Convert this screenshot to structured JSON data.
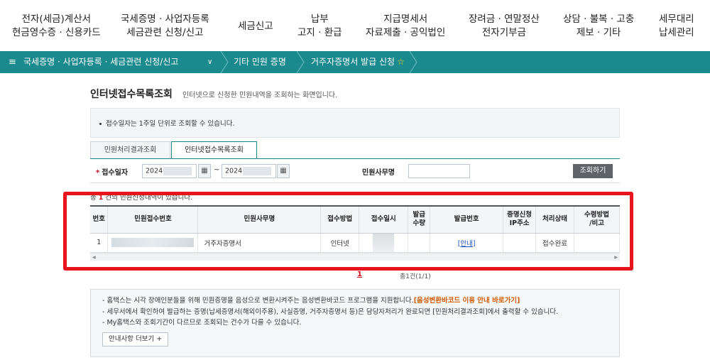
{
  "topnav": [
    {
      "line1": "전자(세금)계산서",
      "line2": "현금영수증 · 신용카드"
    },
    {
      "line1": "국세증명 · 사업자등록",
      "line2": "세금관련 신청/신고"
    },
    {
      "line1": "세금신고",
      "line2": ""
    },
    {
      "line1": "납부",
      "line2": "고지 · 환급"
    },
    {
      "line1": "지급명세서",
      "line2": "자료제출 · 공익법인"
    },
    {
      "line1": "장려금 · 연말정산",
      "line2": "전자기부금"
    },
    {
      "line1": "상담 · 불복 · 고충",
      "line2": "제보 · 기타"
    },
    {
      "line1": "세무대리",
      "line2": "납세관리"
    }
  ],
  "breadcrumb": {
    "menu_icon": "≡",
    "menu_label": "국세증명 · 사업자등록 · 세금관련 신청/신고",
    "chevron": "∨",
    "item2": "기타 민원 증명",
    "item3": "거주자증명서 발급 신청",
    "star": "☆"
  },
  "page": {
    "title": "인터넷접수목록조회",
    "description": "인터넷으로 신청한 민원내역을 조회하는 화면입니다."
  },
  "notice": "접수일자는 1주일 단위로 조회할 수 있습니다.",
  "tabs": {
    "tab1": "민원처리결과조회",
    "tab2": "인터넷접수목록조회"
  },
  "search": {
    "date_label": "접수일자",
    "required_mark": "*",
    "date_from_prefix": "2024",
    "date_to_prefix": "2024",
    "tilde": "~",
    "office_label": "민원사무명",
    "office_value": "",
    "button": "조회하기",
    "calendar_icon": "▦"
  },
  "result_count": {
    "prefix": "총 ",
    "count": "1",
    "suffix": " 건의 민원신청내역이 있습니다."
  },
  "table": {
    "headers": [
      "번호",
      "민원접수번호",
      "민원사무명",
      "접수방법",
      "접수일시",
      "발급\n수량",
      "발급번호",
      "증명신청\nIP주소",
      "처리상태",
      "수령방법\n/비고"
    ],
    "rows": [
      {
        "no": "1",
        "receipt_no": "",
        "office": "거주자증명서",
        "method": "인터넷",
        "datetime": "",
        "qty": "",
        "issue_no": "[안내]",
        "ip": "",
        "status": "접수완료",
        "remark": ""
      }
    ]
  },
  "pagination": {
    "current": "1",
    "total": "총1건(1/1)"
  },
  "info": {
    "line1": "- 홈택스는 시각 장애인분들을 위해 민원증명을 음성으로 변환시켜주는 음성변환바코드 프로그램을 지원합니다.",
    "line1_link": "[음성변환바코드 이용 안내 바로가기]",
    "line2": "- 세무서에서 확인하여 발급하는 증명(납세증명서(해외이주용), 사실증명, 거주자증명서 등)은 담당자처리가 완료되면 [민원처리결과조회]에서 출력할 수 있습니다.",
    "line3": "- My홈택스와 조회기간이 다르므로 조회되는 건수가 다를 수 있습니다.",
    "more_button": "안내사항 더보기 +"
  }
}
